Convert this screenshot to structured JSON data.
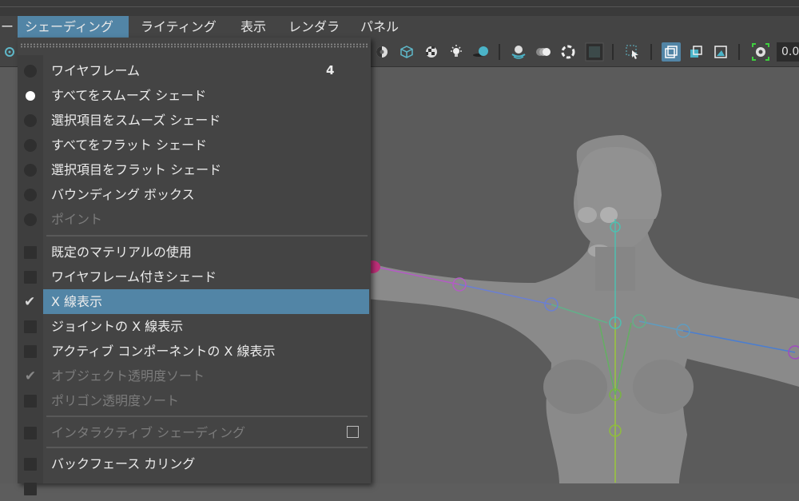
{
  "menubar": {
    "items": [
      {
        "label": "ー"
      },
      {
        "label": "シェーディング"
      },
      {
        "label": "ライティング"
      },
      {
        "label": "表示"
      },
      {
        "label": "レンダラ"
      },
      {
        "label": "パネル"
      }
    ]
  },
  "toolbar": {
    "value": "0.0",
    "icons": [
      "settings-icon",
      "xray-sphere-icon",
      "wireframe-cube-icon",
      "checker-icon",
      "light-bulb-icon",
      "shadow-sphere-icon",
      "ground-plane-icon",
      "motion-blur-icon",
      "ambient-occlusion-icon",
      "anti-alias-icon",
      "select-cursor-icon",
      "isolate-select-icon",
      "isolate-add-icon",
      "image-plane-icon",
      "camera-gate-icon"
    ]
  },
  "shading_menu": {
    "items": [
      {
        "label": "ワイヤフレーム",
        "shortcut": "4",
        "type": "radio",
        "checked": false,
        "enabled": true
      },
      {
        "label": "すべてをスムーズ シェード",
        "type": "radio",
        "checked": true,
        "enabled": true
      },
      {
        "label": "選択項目をスムーズ シェード",
        "type": "radio",
        "checked": false,
        "enabled": true
      },
      {
        "label": "すべてをフラット シェード",
        "type": "radio",
        "checked": false,
        "enabled": true
      },
      {
        "label": "選択項目をフラット シェード",
        "type": "radio",
        "checked": false,
        "enabled": true
      },
      {
        "label": "バウンディング ボックス",
        "type": "radio",
        "checked": false,
        "enabled": true
      },
      {
        "label": "ポイント",
        "type": "radio",
        "checked": false,
        "enabled": false
      },
      {
        "label": "既定のマテリアルの使用",
        "type": "checkbox",
        "checked": false,
        "enabled": true
      },
      {
        "label": "ワイヤフレーム付きシェード",
        "type": "checkbox",
        "checked": false,
        "enabled": true
      },
      {
        "label": "X 線表示",
        "type": "checkbox",
        "checked": true,
        "enabled": true,
        "highlighted": true
      },
      {
        "label": "ジョイントの X 線表示",
        "type": "checkbox",
        "checked": false,
        "enabled": true
      },
      {
        "label": "アクティブ コンポーネントの X 線表示",
        "type": "checkbox",
        "checked": false,
        "enabled": true
      },
      {
        "label": "オブジェクト透明度ソート",
        "type": "checkbox",
        "checked": true,
        "enabled": false
      },
      {
        "label": "ポリゴン透明度ソート",
        "type": "checkbox",
        "checked": false,
        "enabled": false
      },
      {
        "label": "インタラクティブ シェーディング",
        "type": "checkbox",
        "checked": false,
        "enabled": false,
        "option_box": true
      },
      {
        "label": "バックフェース カリング",
        "type": "checkbox",
        "checked": false,
        "enabled": true
      }
    ]
  },
  "colors": {
    "highlight": "#5285a6",
    "menu_bg": "#444444",
    "viewport_bg": "#5b5b5b"
  }
}
